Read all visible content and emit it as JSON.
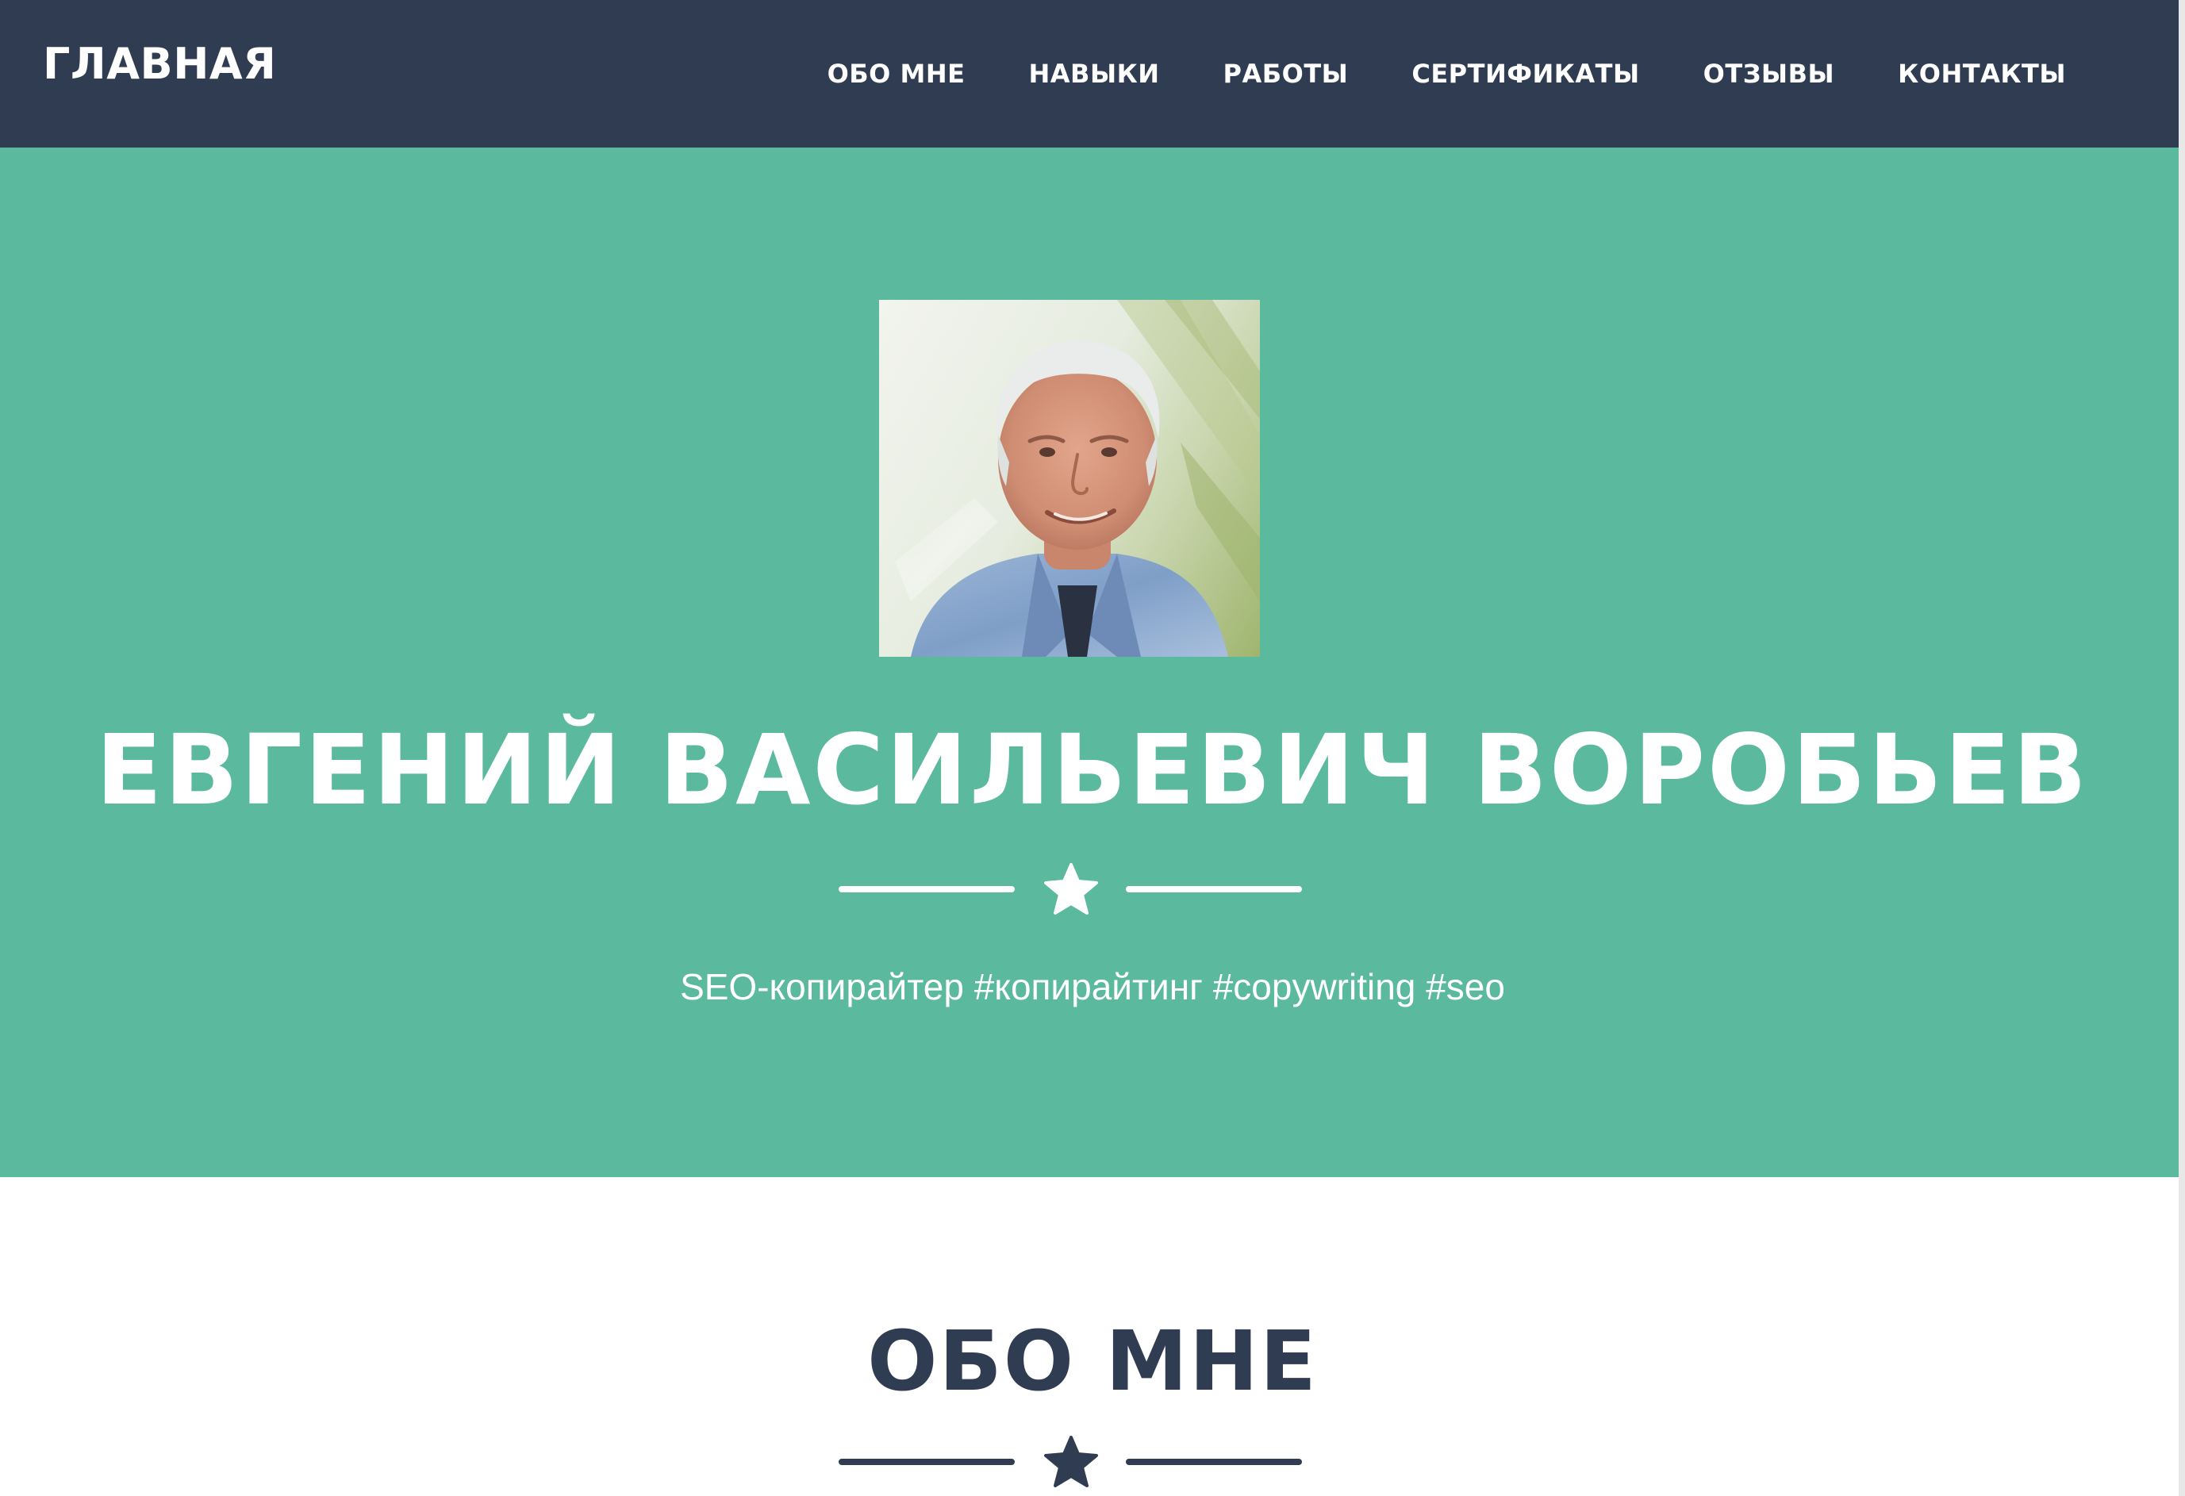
{
  "nav": {
    "brand": "ГЛАВНАЯ",
    "links": [
      "ОБО МНЕ",
      "НАВЫКИ",
      "РАБОТЫ",
      "СЕРТИФИКАТЫ",
      "ОТЗЫВЫ",
      "КОНТАКТЫ"
    ]
  },
  "hero": {
    "name": "ЕВГЕНИЙ ВАСИЛЬЕВИЧ ВОРОБЬЕВ",
    "subtitle": "SEO-копирайтер #копирайтинг #copywriting #seo",
    "divider_icon": "star-icon"
  },
  "about": {
    "title": "ОБО МНЕ",
    "divider_icon": "star-icon"
  },
  "colors": {
    "navbar_bg": "#2f3c51",
    "hero_bg": "#5bb99d",
    "text_light": "#ffffff",
    "text_dark": "#2f3c51"
  }
}
